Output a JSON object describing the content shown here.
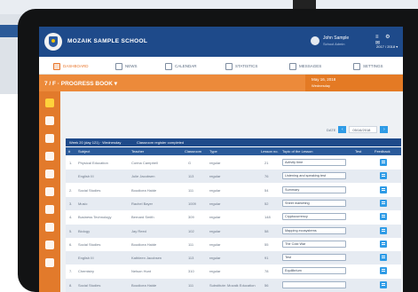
{
  "app": {
    "school_name": "MOZAIK SAMPLE SCHOOL",
    "user_name": "John Sample",
    "user_role": "School Admin",
    "year": "2017 / 2018 ▾",
    "top_icons": "≡ ⚙ ✉"
  },
  "nav": [
    {
      "label": "DASHBOARD",
      "active": true
    },
    {
      "label": "NEWS",
      "active": false
    },
    {
      "label": "CALENDAR",
      "active": false
    },
    {
      "label": "STATISTICS",
      "active": false
    },
    {
      "label": "MESSAGES",
      "active": false
    },
    {
      "label": "SETTINGS",
      "active": false
    }
  ],
  "page": {
    "class_title": "7 / F · PROGRESS BOOK ▾",
    "date_line1": "May 16, 2018",
    "date_line2": "Wednesday"
  },
  "datebar": {
    "label": "DATE",
    "value": "05/16/2018",
    "prev": "‹",
    "next": "›"
  },
  "table": {
    "week_label": "Week 20 (day 121) · Wednesday",
    "week_note": "Classroom register completed",
    "headers": [
      "#",
      "Subject",
      "Teacher",
      "Classroom",
      "Type",
      "Lesson no.",
      "Topic of the Lesson",
      "Test",
      "Feedback"
    ],
    "rows": [
      {
        "num": "1.",
        "subject": "Physical Education",
        "teacher": "Corina Campbell",
        "room": "G",
        "type": "regular",
        "lesson": "21",
        "topic": "Activity time"
      },
      {
        "num": "",
        "subject": "English III",
        "teacher": "Julie Jacobsen",
        "room": "113",
        "type": "regular",
        "lesson": "76",
        "topic": "Listening and speaking test"
      },
      {
        "num": "2.",
        "subject": "Social Studies",
        "teacher": "Boudicea Haide",
        "room": "111",
        "type": "regular",
        "lesson": "54",
        "topic": "Summary"
      },
      {
        "num": "3.",
        "subject": "Music",
        "teacher": "Rachel Bayer",
        "room": "1009",
        "type": "regular",
        "lesson": "52",
        "topic": "Sheet marketing"
      },
      {
        "num": "4.",
        "subject": "Business Technology",
        "teacher": "Bernard Smith",
        "room": "309",
        "type": "regular",
        "lesson": "148",
        "topic": "Cryptocurrency"
      },
      {
        "num": "5.",
        "subject": "Biology",
        "teacher": "Jay Reed",
        "room": "102",
        "type": "regular",
        "lesson": "58",
        "topic": "Mapping ecosystems"
      },
      {
        "num": "6.",
        "subject": "Social Studies",
        "teacher": "Boudicea Haide",
        "room": "111",
        "type": "regular",
        "lesson": "55",
        "topic": "The Cold War"
      },
      {
        "num": "",
        "subject": "English III",
        "teacher": "Kathleen Jacobsen",
        "room": "113",
        "type": "regular",
        "lesson": "91",
        "topic": "Test"
      },
      {
        "num": "7.",
        "subject": "Chemistry",
        "teacher": "Nelson Hunt",
        "room": "310",
        "type": "regular",
        "lesson": "78",
        "topic": "Equilibrium"
      },
      {
        "num": "8.",
        "subject": "Social Studies",
        "teacher": "Boudicea Haide",
        "room": "111",
        "type": "Substitute: Mozaik Education",
        "lesson": "56",
        "topic": ""
      }
    ]
  }
}
